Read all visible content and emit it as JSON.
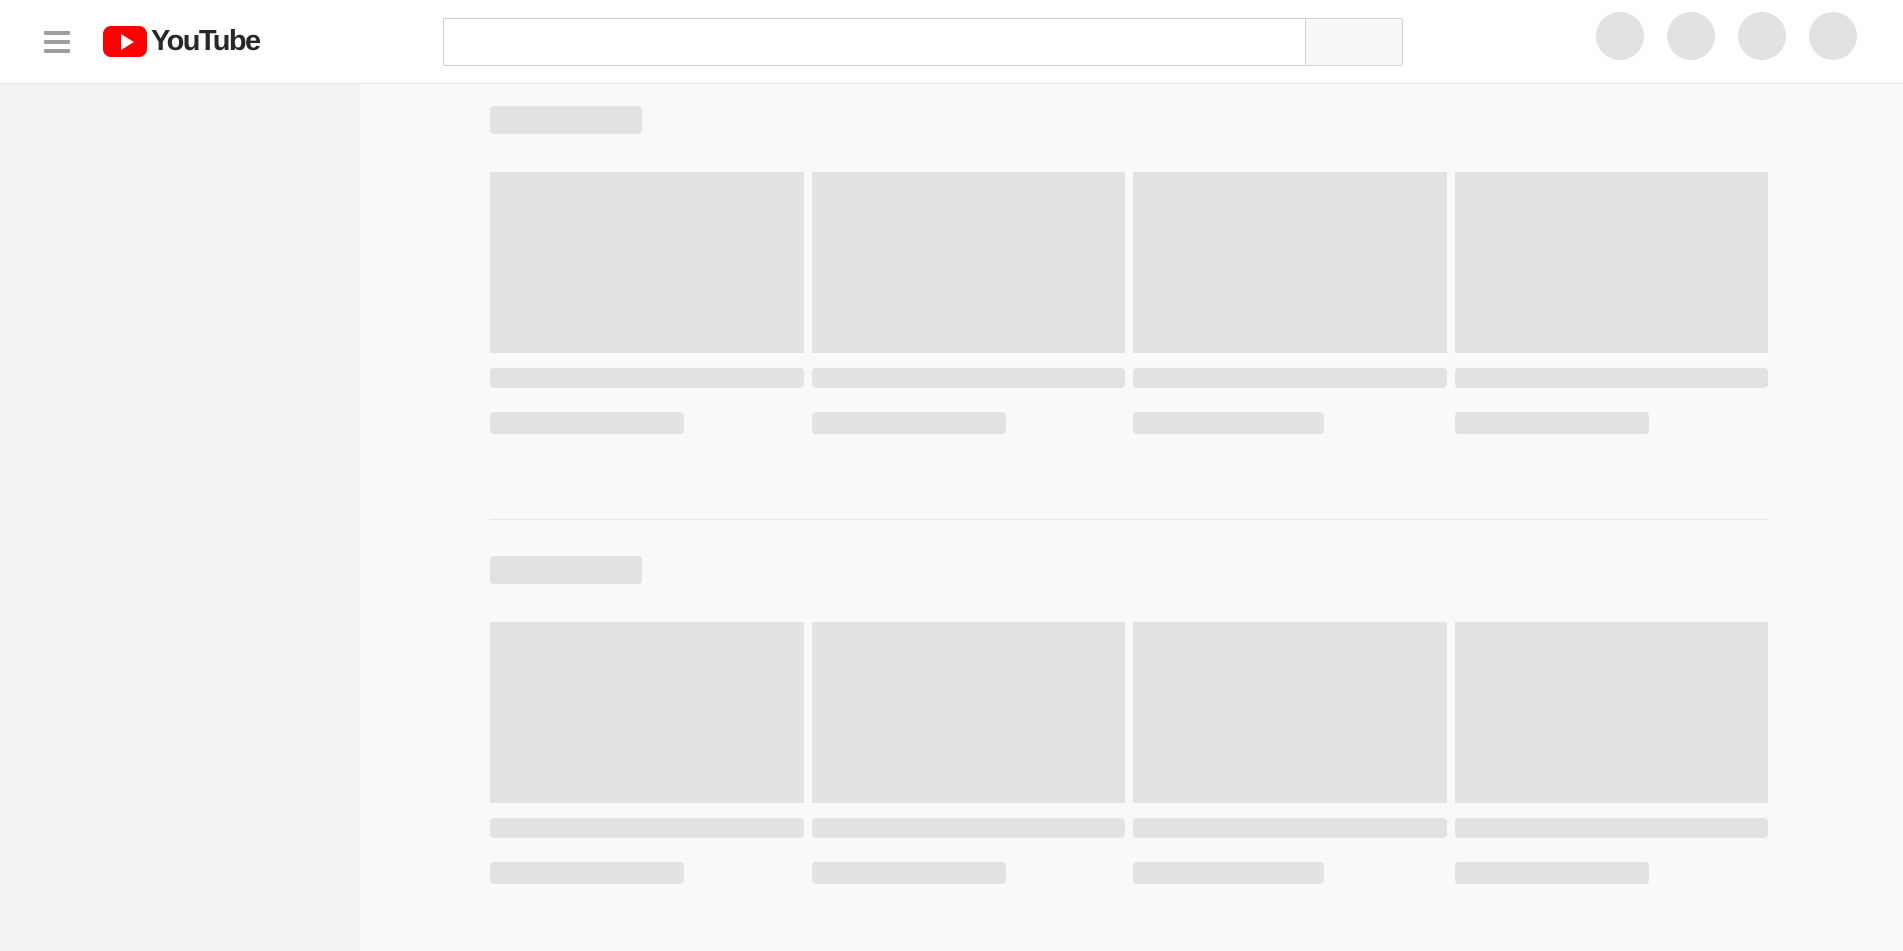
{
  "app": {
    "title": "YouTube",
    "state": "loading-skeleton",
    "colors": {
      "brand_red": "#ff0000",
      "logo_text": "#282828",
      "header_bg": "#ffffff",
      "header_border": "#e5e5e5",
      "sidebar_bg": "#f2f2f2",
      "content_bg": "#f9f9f9",
      "skeleton_fill": "#e2e2e2",
      "divider": "#e8e8e8",
      "search_border": "#cccccc",
      "search_button_bg": "#f8f8f8",
      "hamburger_bar": "#9e9e9e"
    }
  },
  "header": {
    "guide_button": {
      "icon": "hamburger-menu-icon",
      "label": "Guide"
    },
    "logo": {
      "icon": "youtube-play-icon",
      "wordmark": "YouTube"
    },
    "search": {
      "value": "",
      "placeholder": "",
      "button_icon": "search-icon",
      "button_label": ""
    },
    "action_buttons": [
      {
        "name": "create-button-skeleton",
        "icon": "create-icon",
        "label": ""
      },
      {
        "name": "apps-button-skeleton",
        "icon": "apps-grid-icon",
        "label": ""
      },
      {
        "name": "notifications-button-skeleton",
        "icon": "bell-icon",
        "label": ""
      },
      {
        "name": "avatar-button-skeleton",
        "icon": "avatar-icon",
        "label": ""
      }
    ]
  },
  "sidebar": {
    "state": "empty-skeleton",
    "items": []
  },
  "content": {
    "shelves": [
      {
        "name": "shelf-one",
        "title_placeholder": "",
        "cards": [
          {
            "name": "video-card",
            "title_placeholder": "",
            "meta_placeholder": "",
            "meta_width": "52%"
          },
          {
            "name": "video-card",
            "title_placeholder": "",
            "meta_placeholder": "",
            "meta_width": "62%"
          },
          {
            "name": "video-card",
            "title_placeholder": "",
            "meta_placeholder": "",
            "meta_width": "61%"
          },
          {
            "name": "video-card",
            "title_placeholder": "",
            "meta_placeholder": "",
            "meta_width": "62%"
          }
        ]
      },
      {
        "name": "shelf-two",
        "title_placeholder": "",
        "cards": [
          {
            "name": "video-card",
            "title_placeholder": "",
            "meta_placeholder": "",
            "meta_width": "52%"
          },
          {
            "name": "video-card",
            "title_placeholder": "",
            "meta_placeholder": "",
            "meta_width": "62%"
          },
          {
            "name": "video-card",
            "title_placeholder": "",
            "meta_placeholder": "",
            "meta_width": "61%"
          },
          {
            "name": "video-card",
            "title_placeholder": "",
            "meta_placeholder": "",
            "meta_width": "62%"
          }
        ]
      }
    ]
  }
}
